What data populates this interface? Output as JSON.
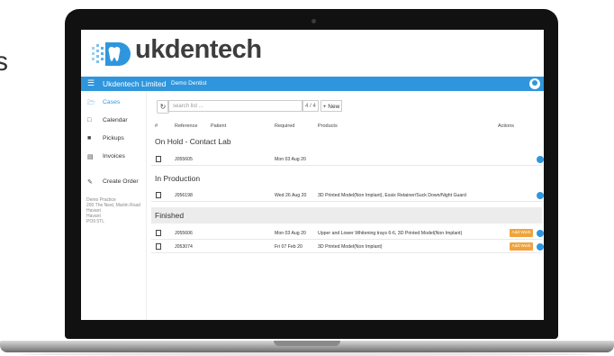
{
  "left_letter": "s",
  "logo": {
    "name": "ukdentech"
  },
  "topbar": {
    "brand": "Ukdentech Limited",
    "user": "Demo Dentist",
    "menu_icon": "menu-icon"
  },
  "sidebar": {
    "items": [
      {
        "label": "Cases",
        "icon": "folder-icon",
        "active": true
      },
      {
        "label": "Calendar",
        "icon": "calendar-icon"
      },
      {
        "label": "Pickups",
        "icon": "truck-icon"
      },
      {
        "label": "Invoices",
        "icon": "invoice-icon"
      },
      {
        "label": "Create Order",
        "icon": "edit-icon"
      }
    ],
    "address": [
      "Demo Practice",
      "200 The Nest, Martin Road",
      "Havant",
      "Havant",
      "PO9 5TL"
    ]
  },
  "toolbar": {
    "search_placeholder": "search list ...",
    "count": "4 / 4",
    "new_label": "+ New"
  },
  "table": {
    "headers": {
      "num": "#",
      "reference": "Reference",
      "patient": "Patient",
      "required": "Required",
      "products": "Products",
      "actions": "Actions"
    },
    "sections": [
      {
        "title": "On Hold - Contact Lab",
        "rows": [
          {
            "reference": "J055605",
            "required": "Mon 03 Aug 20",
            "products": "",
            "add_work": ""
          }
        ]
      },
      {
        "title": "In Production",
        "rows": [
          {
            "reference": "J056198",
            "required": "Wed 26 Aug 20",
            "products": "3D Printed Model(Non Implant), Essix Retainer/Suck Down/Night Guard",
            "add_work": ""
          }
        ]
      },
      {
        "title": "Finished",
        "rows": [
          {
            "reference": "J055606",
            "required": "Mon 03 Aug 20",
            "products": "Upper and Lower Whitening trays 6-6, 3D Printed Model(Non Implant)",
            "add_work": "Add Work"
          },
          {
            "reference": "J053074",
            "required": "Fri 07 Feb 20",
            "products": "3D Printed Model(Non Implant)",
            "add_work": "Add Work"
          }
        ]
      }
    ]
  },
  "colors": {
    "accent": "#2f96dd",
    "add_work": "#f0a33c"
  }
}
